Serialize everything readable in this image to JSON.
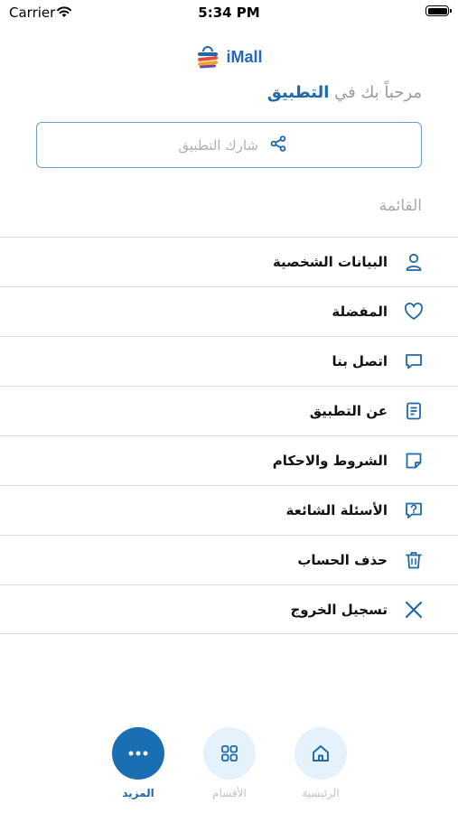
{
  "status_bar": {
    "carrier": "Carrier",
    "time": "5:34 PM"
  },
  "logo": {
    "text": "iMall"
  },
  "welcome": {
    "prefix": "مرحباً بك في ",
    "app_word": "التطبيق"
  },
  "share": {
    "label": "شارك التطبيق",
    "icon": "share-icon"
  },
  "menu": {
    "title": "القائمة",
    "items": [
      {
        "label": "البيانات الشخصية",
        "icon": "user-icon"
      },
      {
        "label": "المفضلة",
        "icon": "heart-icon"
      },
      {
        "label": "اتصل بنا",
        "icon": "chat-icon"
      },
      {
        "label": "عن التطبيق",
        "icon": "document-icon"
      },
      {
        "label": "الشروط والاحكام",
        "icon": "note-icon"
      },
      {
        "label": "الأسئلة الشائعة",
        "icon": "question-icon"
      },
      {
        "label": "حذف الحساب",
        "icon": "trash-icon"
      },
      {
        "label": "تسجيل الخروج",
        "icon": "close-icon"
      }
    ]
  },
  "tabs": [
    {
      "label": "الرئيسية",
      "icon": "home-icon",
      "active": false
    },
    {
      "label": "الأقسام",
      "icon": "grid-icon",
      "active": false
    },
    {
      "label": "المزيد",
      "icon": "more-icon",
      "active": true
    }
  ],
  "colors": {
    "accent": "#1a6fb2",
    "tab_inactive_bg": "#e6f2fb",
    "divider": "#dcdcdc"
  }
}
